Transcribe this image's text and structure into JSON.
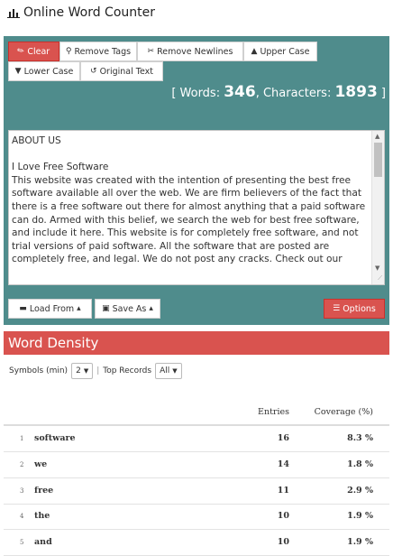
{
  "app": {
    "title": "Online Word Counter"
  },
  "toolbar": {
    "clear": "Clear",
    "remove_tags": "Remove Tags",
    "remove_newlines": "Remove Newlines",
    "upper_case": "Upper Case",
    "lower_case": "Lower Case",
    "original_text": "Original Text"
  },
  "counts": {
    "open": "[ Words: ",
    "words": "346",
    "mid": ", Characters: ",
    "characters": "1893",
    "close": " ]"
  },
  "editor": {
    "text": "ABOUT US\n\nI Love Free Software\nThis website was created with the intention of presenting the best free software available all over the web. We are firm believers of the fact that there is a free software out there for almost anything that a paid software can do. Armed with this belief, we search the web for best free software, and include it here. This website is for completely free software, and not trial versions of paid software. All the software that are posted are completely free, and legal. We do not post any cracks. Check out our"
  },
  "bottom_bar": {
    "load_from": "Load From",
    "save_as": "Save As",
    "options": "Options"
  },
  "word_density": {
    "title": "Word Density",
    "symbols_label": "Symbols (min)",
    "symbols_value": "2",
    "separator": "|",
    "top_records_label": "Top Records",
    "top_records_value": "All",
    "columns": {
      "entries": "Entries",
      "coverage": "Coverage (%)"
    },
    "rows": [
      {
        "rank": "1",
        "word": "software",
        "entries": "16",
        "coverage": "8.3 %"
      },
      {
        "rank": "2",
        "word": "we",
        "entries": "14",
        "coverage": "1.8 %"
      },
      {
        "rank": "3",
        "word": "free",
        "entries": "11",
        "coverage": "2.9 %"
      },
      {
        "rank": "4",
        "word": "the",
        "entries": "10",
        "coverage": "1.9 %"
      },
      {
        "rank": "5",
        "word": "and",
        "entries": "10",
        "coverage": "1.9 %"
      }
    ]
  }
}
